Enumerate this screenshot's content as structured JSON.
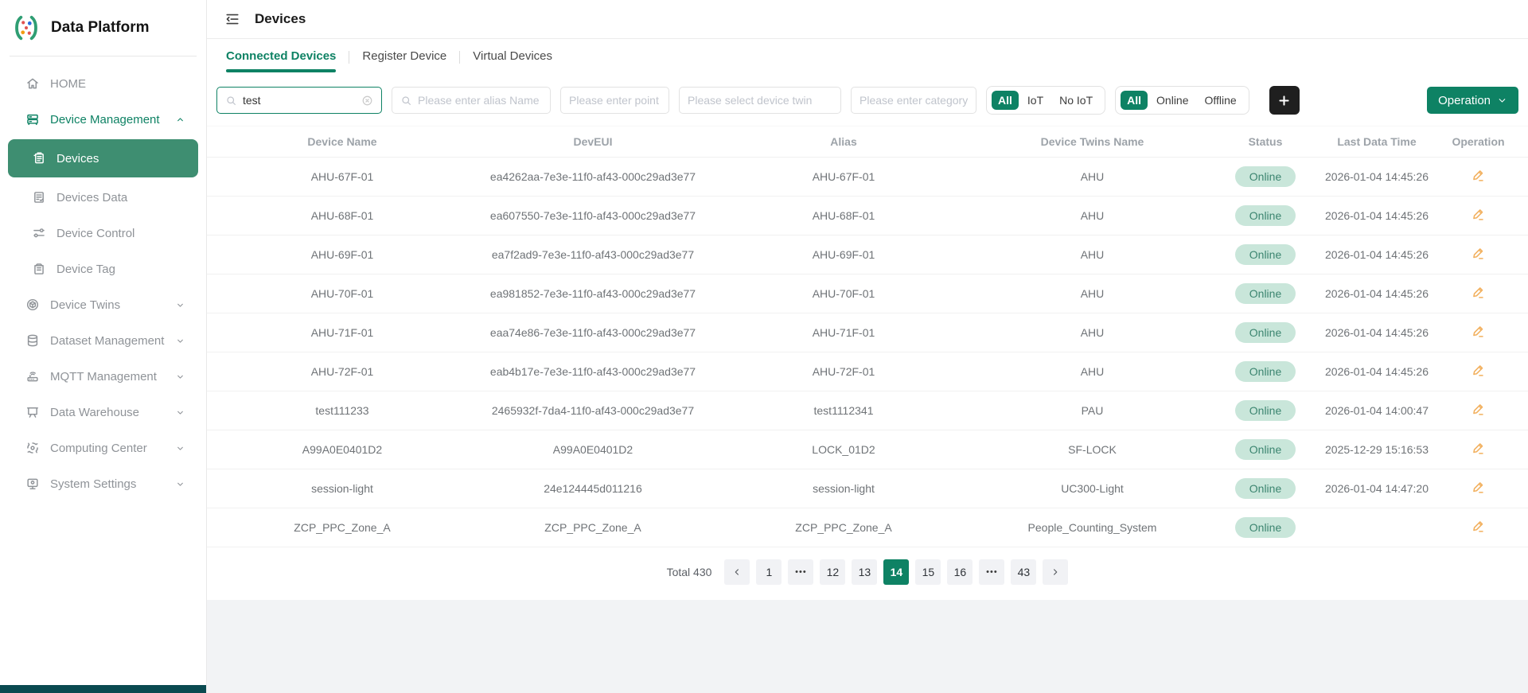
{
  "app_title": "Data Platform",
  "colors": {
    "accent": "#0E8264",
    "sidebar_selected": "#3E8E71",
    "status_badge_bg": "#C9E6DA",
    "status_badge_text": "#3C8570",
    "edit_icon": "#F2B05E",
    "add_button_bg": "#1F1F1F",
    "sidebar_bottom_bar": "#0A4A50"
  },
  "sidebar": {
    "items": [
      {
        "label": "HOME",
        "icon": "home",
        "level": "top",
        "chevron": null,
        "state": "normal"
      },
      {
        "label": "Device Management",
        "icon": "device-management",
        "level": "top",
        "chevron": "up",
        "state": "parent-active"
      },
      {
        "label": "Devices",
        "icon": "devices",
        "level": "sub",
        "chevron": null,
        "state": "selected"
      },
      {
        "label": "Devices Data",
        "icon": "devices-data",
        "level": "sub",
        "chevron": null,
        "state": "normal"
      },
      {
        "label": "Device Control",
        "icon": "device-control",
        "level": "sub",
        "chevron": null,
        "state": "normal"
      },
      {
        "label": "Device Tag",
        "icon": "device-tag",
        "level": "sub",
        "chevron": null,
        "state": "normal"
      },
      {
        "label": "Device Twins",
        "icon": "device-twins",
        "level": "top",
        "chevron": "down",
        "state": "normal"
      },
      {
        "label": "Dataset Management",
        "icon": "dataset-management",
        "level": "top",
        "chevron": "down",
        "state": "normal"
      },
      {
        "label": "MQTT Management",
        "icon": "mqtt-management",
        "level": "top",
        "chevron": "down",
        "state": "normal"
      },
      {
        "label": "Data Warehouse",
        "icon": "data-warehouse",
        "level": "top",
        "chevron": "down",
        "state": "normal"
      },
      {
        "label": "Computing Center",
        "icon": "computing-center",
        "level": "top",
        "chevron": "down",
        "state": "normal"
      },
      {
        "label": "System Settings",
        "icon": "system-settings",
        "level": "top",
        "chevron": "down",
        "state": "normal"
      }
    ]
  },
  "topbar": {
    "title": "Devices"
  },
  "tabs": [
    {
      "label": "Connected Devices",
      "active": true
    },
    {
      "label": "Register Device",
      "active": false
    },
    {
      "label": "Virtual Devices",
      "active": false
    }
  ],
  "filters": {
    "search_value": "test",
    "alias_placeholder": "Please enter alias Name",
    "point_placeholder": "Please enter point",
    "twin_placeholder": "Please select device twin",
    "category_placeholder": "Please enter category",
    "iot_filter": {
      "options": [
        "All",
        "IoT",
        "No IoT"
      ],
      "selected": "All"
    },
    "status_filter": {
      "options": [
        "All",
        "Online",
        "Offline"
      ],
      "selected": "All"
    },
    "operation_label": "Operation"
  },
  "table": {
    "columns": [
      "Device Name",
      "DevEUI",
      "Alias",
      "Device Twins Name",
      "Status",
      "Last Data Time",
      "Operation"
    ],
    "rows": [
      {
        "device_name": "AHU-67F-01",
        "deveui": "ea4262aa-7e3e-11f0-af43-000c29ad3e77",
        "alias": "AHU-67F-01",
        "twins": "AHU",
        "status": "Online",
        "last_data_time": "2026-01-04 14:45:26"
      },
      {
        "device_name": "AHU-68F-01",
        "deveui": "ea607550-7e3e-11f0-af43-000c29ad3e77",
        "alias": "AHU-68F-01",
        "twins": "AHU",
        "status": "Online",
        "last_data_time": "2026-01-04 14:45:26"
      },
      {
        "device_name": "AHU-69F-01",
        "deveui": "ea7f2ad9-7e3e-11f0-af43-000c29ad3e77",
        "alias": "AHU-69F-01",
        "twins": "AHU",
        "status": "Online",
        "last_data_time": "2026-01-04 14:45:26"
      },
      {
        "device_name": "AHU-70F-01",
        "deveui": "ea981852-7e3e-11f0-af43-000c29ad3e77",
        "alias": "AHU-70F-01",
        "twins": "AHU",
        "status": "Online",
        "last_data_time": "2026-01-04 14:45:26"
      },
      {
        "device_name": "AHU-71F-01",
        "deveui": "eaa74e86-7e3e-11f0-af43-000c29ad3e77",
        "alias": "AHU-71F-01",
        "twins": "AHU",
        "status": "Online",
        "last_data_time": "2026-01-04 14:45:26"
      },
      {
        "device_name": "AHU-72F-01",
        "deveui": "eab4b17e-7e3e-11f0-af43-000c29ad3e77",
        "alias": "AHU-72F-01",
        "twins": "AHU",
        "status": "Online",
        "last_data_time": "2026-01-04 14:45:26"
      },
      {
        "device_name": "test111233",
        "deveui": "2465932f-7da4-11f0-af43-000c29ad3e77",
        "alias": "test1112341",
        "twins": "PAU",
        "status": "Online",
        "last_data_time": "2026-01-04 14:00:47"
      },
      {
        "device_name": "A99A0E0401D2",
        "deveui": "A99A0E0401D2",
        "alias": "LOCK_01D2",
        "twins": "SF-LOCK",
        "status": "Online",
        "last_data_time": "2025-12-29 15:16:53"
      },
      {
        "device_name": "session-light",
        "deveui": "24e124445d011216",
        "alias": "session-light",
        "twins": "UC300-Light",
        "status": "Online",
        "last_data_time": "2026-01-04 14:47:20"
      },
      {
        "device_name": "ZCP_PPC_Zone_A",
        "deveui": "ZCP_PPC_Zone_A",
        "alias": "ZCP_PPC_Zone_A",
        "twins": "People_Counting_System",
        "status": "Online",
        "last_data_time": ""
      }
    ]
  },
  "pagination": {
    "total_label": "Total 430",
    "pages": [
      "1",
      "•••",
      "12",
      "13",
      "14",
      "15",
      "16",
      "•••",
      "43"
    ],
    "active_page": "14"
  }
}
